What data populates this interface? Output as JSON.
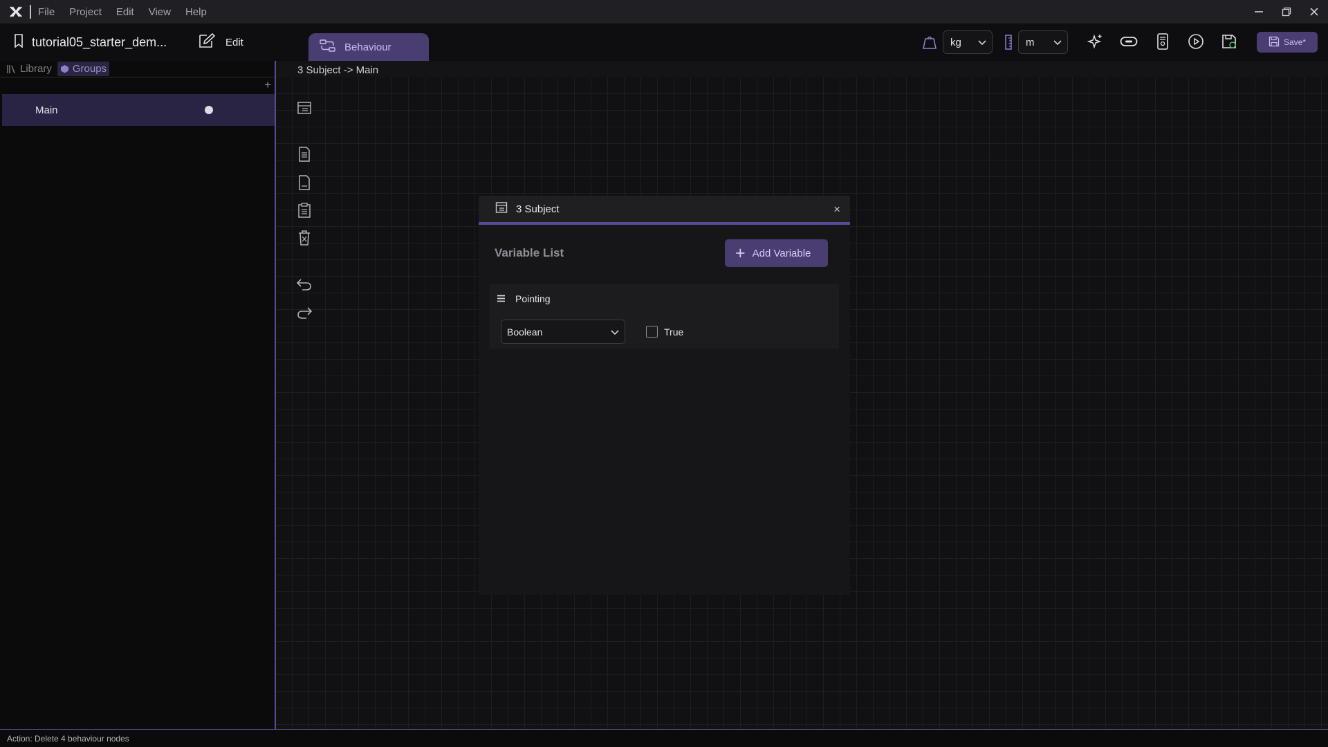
{
  "menubar": {
    "items": [
      "File",
      "Project",
      "Edit",
      "View",
      "Help"
    ]
  },
  "toolbar": {
    "project_name": "tutorial05_starter_dem...",
    "edit_label": "Edit",
    "behaviour_tab": "Behaviour",
    "mass_unit": "kg",
    "length_unit": "m",
    "save_label": "Save*"
  },
  "left_panel": {
    "tabs": [
      "Library",
      "Groups"
    ],
    "active_tab": "Groups",
    "add_symbol": "+",
    "groups": [
      {
        "label": "Main"
      }
    ]
  },
  "breadcrumb": "3 Subject -> Main",
  "dialog": {
    "title": "3 Subject",
    "close_symbol": "×",
    "list_title": "Variable List",
    "add_button": "Add Variable",
    "variables": [
      {
        "name": "Pointing",
        "type": "Boolean",
        "value_label": "True",
        "checked": false
      }
    ]
  },
  "status": "Action: Delete 4 behaviour nodes",
  "colors": {
    "accent": "#4a3d72",
    "accent_text": "#c7bdf0",
    "selection": "#2a2444"
  },
  "icons": {
    "app": "app-logo-icon",
    "project": "bookmark-icon",
    "edit": "edit-icon",
    "behaviour": "flow-icon",
    "mass": "weight-icon",
    "length": "ruler-icon",
    "ai": "sparkle-icon",
    "vr": "vr-headset-icon",
    "device": "device-icon",
    "play": "play-icon",
    "export": "export-icon",
    "save": "save-icon"
  }
}
